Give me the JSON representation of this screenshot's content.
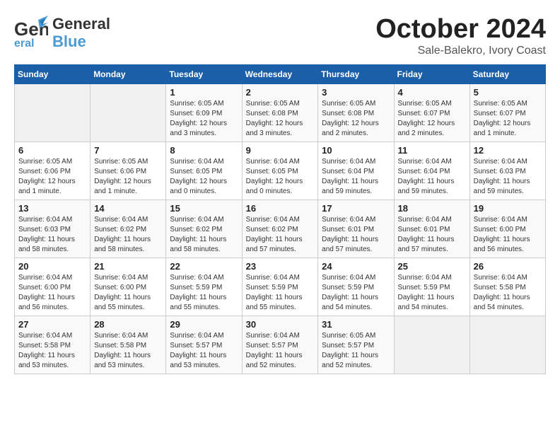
{
  "header": {
    "logo_general": "General",
    "logo_blue": "Blue",
    "month_title": "October 2024",
    "subtitle": "Sale-Balekro, Ivory Coast"
  },
  "weekdays": [
    "Sunday",
    "Monday",
    "Tuesday",
    "Wednesday",
    "Thursday",
    "Friday",
    "Saturday"
  ],
  "weeks": [
    [
      {
        "day": "",
        "info": ""
      },
      {
        "day": "",
        "info": ""
      },
      {
        "day": "1",
        "info": "Sunrise: 6:05 AM\nSunset: 6:09 PM\nDaylight: 12 hours and 3 minutes."
      },
      {
        "day": "2",
        "info": "Sunrise: 6:05 AM\nSunset: 6:08 PM\nDaylight: 12 hours and 3 minutes."
      },
      {
        "day": "3",
        "info": "Sunrise: 6:05 AM\nSunset: 6:08 PM\nDaylight: 12 hours and 2 minutes."
      },
      {
        "day": "4",
        "info": "Sunrise: 6:05 AM\nSunset: 6:07 PM\nDaylight: 12 hours and 2 minutes."
      },
      {
        "day": "5",
        "info": "Sunrise: 6:05 AM\nSunset: 6:07 PM\nDaylight: 12 hours and 1 minute."
      }
    ],
    [
      {
        "day": "6",
        "info": "Sunrise: 6:05 AM\nSunset: 6:06 PM\nDaylight: 12 hours and 1 minute."
      },
      {
        "day": "7",
        "info": "Sunrise: 6:05 AM\nSunset: 6:06 PM\nDaylight: 12 hours and 1 minute."
      },
      {
        "day": "8",
        "info": "Sunrise: 6:04 AM\nSunset: 6:05 PM\nDaylight: 12 hours and 0 minutes."
      },
      {
        "day": "9",
        "info": "Sunrise: 6:04 AM\nSunset: 6:05 PM\nDaylight: 12 hours and 0 minutes."
      },
      {
        "day": "10",
        "info": "Sunrise: 6:04 AM\nSunset: 6:04 PM\nDaylight: 11 hours and 59 minutes."
      },
      {
        "day": "11",
        "info": "Sunrise: 6:04 AM\nSunset: 6:04 PM\nDaylight: 11 hours and 59 minutes."
      },
      {
        "day": "12",
        "info": "Sunrise: 6:04 AM\nSunset: 6:03 PM\nDaylight: 11 hours and 59 minutes."
      }
    ],
    [
      {
        "day": "13",
        "info": "Sunrise: 6:04 AM\nSunset: 6:03 PM\nDaylight: 11 hours and 58 minutes."
      },
      {
        "day": "14",
        "info": "Sunrise: 6:04 AM\nSunset: 6:02 PM\nDaylight: 11 hours and 58 minutes."
      },
      {
        "day": "15",
        "info": "Sunrise: 6:04 AM\nSunset: 6:02 PM\nDaylight: 11 hours and 58 minutes."
      },
      {
        "day": "16",
        "info": "Sunrise: 6:04 AM\nSunset: 6:02 PM\nDaylight: 11 hours and 57 minutes."
      },
      {
        "day": "17",
        "info": "Sunrise: 6:04 AM\nSunset: 6:01 PM\nDaylight: 11 hours and 57 minutes."
      },
      {
        "day": "18",
        "info": "Sunrise: 6:04 AM\nSunset: 6:01 PM\nDaylight: 11 hours and 57 minutes."
      },
      {
        "day": "19",
        "info": "Sunrise: 6:04 AM\nSunset: 6:00 PM\nDaylight: 11 hours and 56 minutes."
      }
    ],
    [
      {
        "day": "20",
        "info": "Sunrise: 6:04 AM\nSunset: 6:00 PM\nDaylight: 11 hours and 56 minutes."
      },
      {
        "day": "21",
        "info": "Sunrise: 6:04 AM\nSunset: 6:00 PM\nDaylight: 11 hours and 55 minutes."
      },
      {
        "day": "22",
        "info": "Sunrise: 6:04 AM\nSunset: 5:59 PM\nDaylight: 11 hours and 55 minutes."
      },
      {
        "day": "23",
        "info": "Sunrise: 6:04 AM\nSunset: 5:59 PM\nDaylight: 11 hours and 55 minutes."
      },
      {
        "day": "24",
        "info": "Sunrise: 6:04 AM\nSunset: 5:59 PM\nDaylight: 11 hours and 54 minutes."
      },
      {
        "day": "25",
        "info": "Sunrise: 6:04 AM\nSunset: 5:59 PM\nDaylight: 11 hours and 54 minutes."
      },
      {
        "day": "26",
        "info": "Sunrise: 6:04 AM\nSunset: 5:58 PM\nDaylight: 11 hours and 54 minutes."
      }
    ],
    [
      {
        "day": "27",
        "info": "Sunrise: 6:04 AM\nSunset: 5:58 PM\nDaylight: 11 hours and 53 minutes."
      },
      {
        "day": "28",
        "info": "Sunrise: 6:04 AM\nSunset: 5:58 PM\nDaylight: 11 hours and 53 minutes."
      },
      {
        "day": "29",
        "info": "Sunrise: 6:04 AM\nSunset: 5:57 PM\nDaylight: 11 hours and 53 minutes."
      },
      {
        "day": "30",
        "info": "Sunrise: 6:04 AM\nSunset: 5:57 PM\nDaylight: 11 hours and 52 minutes."
      },
      {
        "day": "31",
        "info": "Sunrise: 6:05 AM\nSunset: 5:57 PM\nDaylight: 11 hours and 52 minutes."
      },
      {
        "day": "",
        "info": ""
      },
      {
        "day": "",
        "info": ""
      }
    ]
  ]
}
